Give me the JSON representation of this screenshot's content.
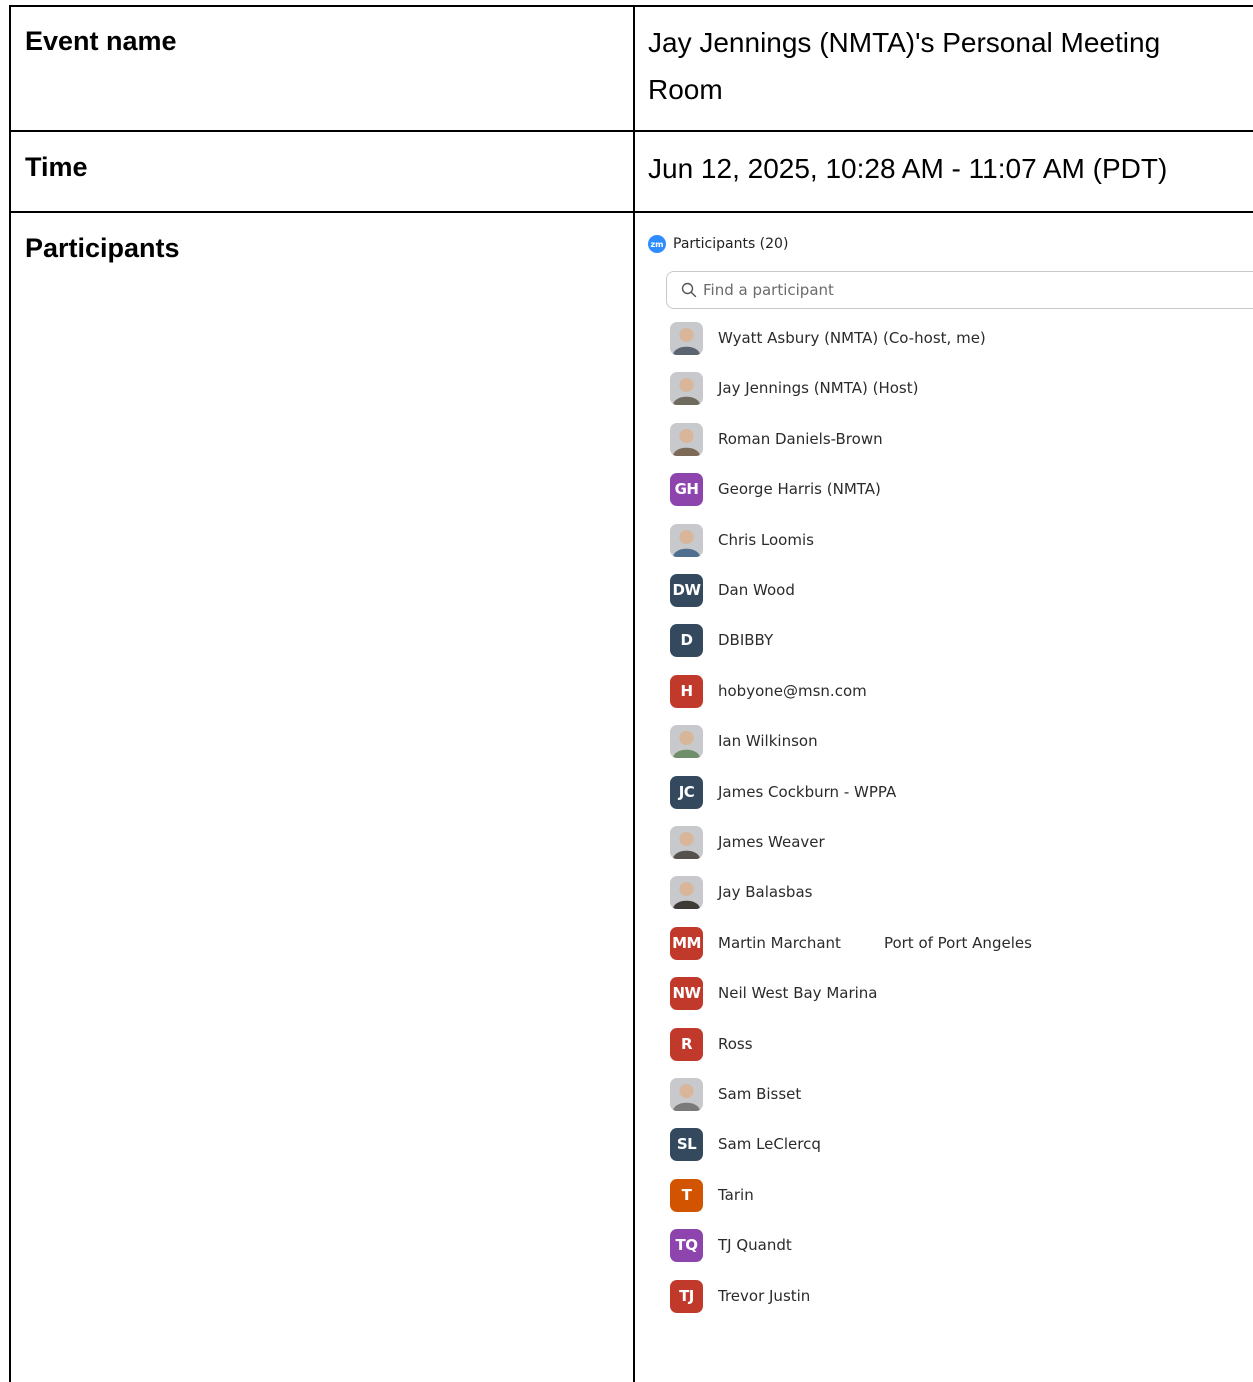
{
  "rows": {
    "event": {
      "label": "Event name",
      "value": "Jay Jennings (NMTA)'s Personal Meeting Room"
    },
    "time": {
      "label": "Time",
      "value": "Jun 12, 2025, 10:28 AM - 11:07 AM (PDT)"
    },
    "participants": {
      "label": "Participants"
    }
  },
  "zoom_panel": {
    "logo_text": "zm",
    "title": "Participants (20)",
    "search_placeholder": "Find a participant",
    "participants": [
      {
        "name": "Wyatt Asbury (NMTA) (Co-host, me)",
        "avatar": "photo",
        "photo_color": "#5b6470"
      },
      {
        "name": "Jay Jennings (NMTA) (Host)",
        "avatar": "photo",
        "photo_color": "#6e6a5e"
      },
      {
        "name": "Roman Daniels-Brown",
        "avatar": "photo",
        "photo_color": "#7c6a56"
      },
      {
        "name": "George Harris (NMTA)",
        "avatar": "initials",
        "initials": "GH",
        "color": "#8e44ad"
      },
      {
        "name": "Chris Loomis",
        "avatar": "photo",
        "photo_color": "#4f6f8f"
      },
      {
        "name": "Dan Wood",
        "avatar": "initials",
        "initials": "DW",
        "color": "#34495e"
      },
      {
        "name": "DBIBBY",
        "avatar": "initials",
        "initials": "D",
        "color": "#34495e"
      },
      {
        "name": "hobyone@msn.com",
        "avatar": "initials",
        "initials": "H",
        "color": "#c0392b"
      },
      {
        "name": "Ian Wilkinson",
        "avatar": "photo",
        "photo_color": "#6f8f6a"
      },
      {
        "name": "James Cockburn - WPPA",
        "avatar": "initials",
        "initials": "JC",
        "color": "#34495e"
      },
      {
        "name": "James Weaver",
        "avatar": "photo",
        "photo_color": "#55524d"
      },
      {
        "name": "Jay Balasbas",
        "avatar": "photo",
        "photo_color": "#3e3a36"
      },
      {
        "name": "Martin Marchant",
        "note": "Port of Port Angeles",
        "avatar": "initials",
        "initials": "MM",
        "color": "#c0392b"
      },
      {
        "name": "Neil West Bay Marina",
        "avatar": "initials",
        "initials": "NW",
        "color": "#c0392b"
      },
      {
        "name": "Ross",
        "avatar": "initials",
        "initials": "R",
        "color": "#c0392b"
      },
      {
        "name": "Sam Bisset",
        "avatar": "photo",
        "photo_color": "#7a7a7a"
      },
      {
        "name": "Sam LeClercq",
        "avatar": "initials",
        "initials": "SL",
        "color": "#34495e"
      },
      {
        "name": "Tarin",
        "avatar": "initials",
        "initials": "T",
        "color": "#d35400"
      },
      {
        "name": "TJ Quandt",
        "avatar": "initials",
        "initials": "TQ",
        "color": "#8e44ad"
      },
      {
        "name": "Trevor Justin",
        "avatar": "initials",
        "initials": "TJ",
        "color": "#c0392b"
      }
    ]
  }
}
